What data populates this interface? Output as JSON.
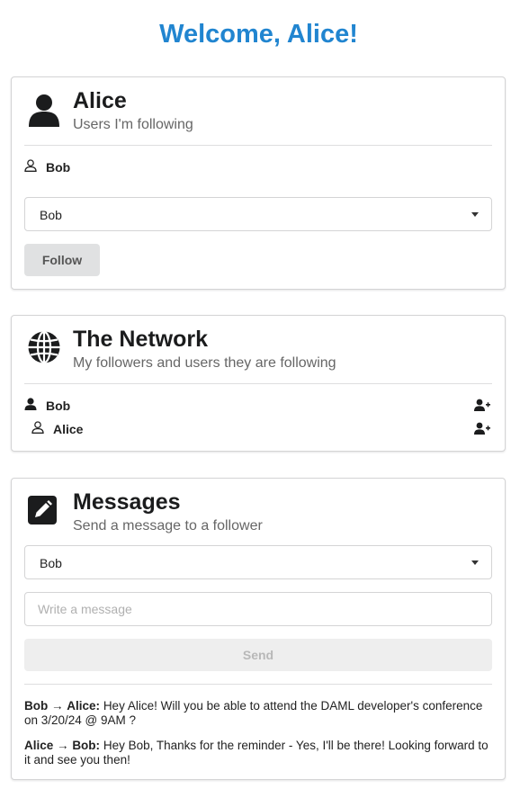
{
  "page": {
    "title": "Welcome, Alice!"
  },
  "profile": {
    "name": "Alice",
    "subtitle": "Users I'm following",
    "following": [
      {
        "name": "Bob"
      }
    ],
    "dropdown_value": "Bob",
    "follow_label": "Follow"
  },
  "network": {
    "title": "The Network",
    "subtitle": "My followers and users they are following",
    "members": [
      {
        "name": "Bob",
        "icon": "user-solid-icon"
      },
      {
        "name": "Alice",
        "icon": "user-outline-icon"
      }
    ]
  },
  "messages": {
    "title": "Messages",
    "subtitle": "Send a message to a follower",
    "recipient_value": "Bob",
    "input_placeholder": "Write a message",
    "send_label": "Send",
    "items": [
      {
        "from": "Bob",
        "arrow": "→",
        "to": "Alice:",
        "text": "Hey Alice! Will you be able to attend the DAML developer's conference on 3/20/24 @ 9AM ?"
      },
      {
        "from": "Alice",
        "arrow": "→",
        "to": "Bob:",
        "text": "Hey Bob, Thanks for the reminder - Yes, I'll be there! Looking forward to it and see you then!"
      }
    ]
  },
  "colors": {
    "accent": "#2185d0",
    "title": "#1b1c1d",
    "muted": "#666666"
  }
}
